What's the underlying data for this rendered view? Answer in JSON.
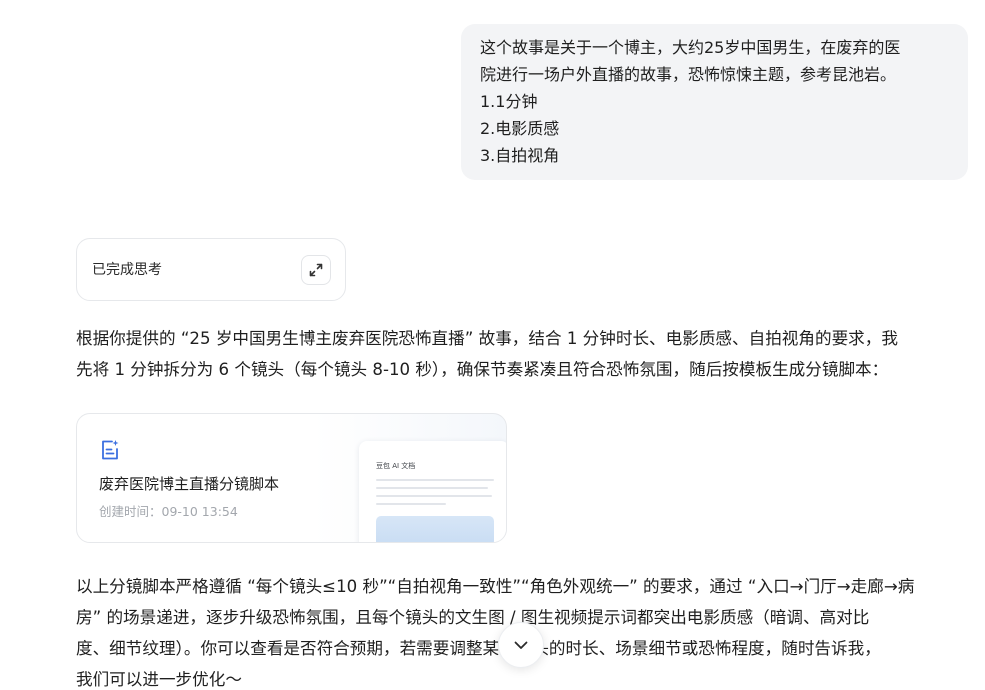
{
  "user_message": {
    "lines": [
      "这个故事是关于一个博主，大约25岁中国男生，在废弃的医",
      "院进行一场户外直播的故事，恐怖惊悚主题，参考昆池岩。",
      "1.1分钟",
      "2.电影质感",
      "3.自拍视角"
    ]
  },
  "thinking": {
    "label": "已完成思考",
    "expand_icon": "expand-icon"
  },
  "reply": {
    "intro_lines": [
      "根据你提供的 “25 岁中国男生博主废弃医院恐怖直播” 故事，结合 1 分钟时长、电影质感、自拍视角的要求，我",
      "先将 1 分钟拆分为 6 个镜头（每个镜头 8-10 秒），确保节奏紧凑且符合恐怖氛围，随后按模板生成分镜脚本："
    ],
    "document_card": {
      "icon": "document-ai-icon",
      "title": "废弃医院博主直播分镜脚本",
      "meta": "创建时间：09-10 13:54",
      "preview_title": "豆包 AI 文档",
      "accent_color": "#3b6fe0"
    },
    "outro_lines": [
      "以上分镜脚本严格遵循 “每个镜头≤10 秒”“自拍视角一致性”“角色外观统一” 的要求，通过 “入口→门厅→走廊→病",
      "房” 的场景递进，逐步升级恐怖氛围，且每个镜头的文生图 / 图生视频提示词都突出电影质感（暗调、高对比",
      "度、细节纹理）。你可以查看是否符合预期，若需要调整某个镜头的时长、场景细节或恐怖程度，随时告诉我，",
      "我们可以进一步优化～"
    ]
  },
  "scroll_button": {
    "icon": "chevron-down-icon"
  }
}
